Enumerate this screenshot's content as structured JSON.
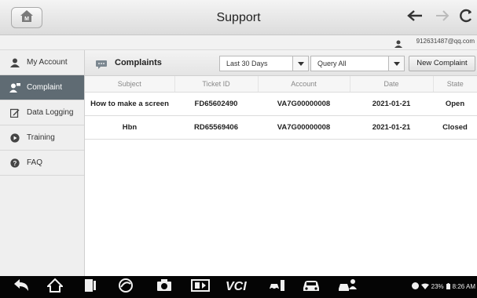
{
  "header": {
    "title": "Support"
  },
  "user": {
    "email": "912631487@qq.com"
  },
  "sidebar": {
    "items": [
      {
        "label": "My Account",
        "icon": "person-icon",
        "active": false
      },
      {
        "label": "Complaint",
        "icon": "complaint-icon",
        "active": true
      },
      {
        "label": "Data Logging",
        "icon": "edit-icon",
        "active": false
      },
      {
        "label": "Training",
        "icon": "play-icon",
        "active": false
      },
      {
        "label": "FAQ",
        "icon": "help-icon",
        "active": false
      }
    ]
  },
  "toolbar": {
    "title": "Complaints",
    "period_select": "Last 30 Days",
    "query_select": "Query All",
    "new_button": "New Complaint"
  },
  "table": {
    "columns": [
      "Subject",
      "Ticket ID",
      "Account",
      "Date",
      "State"
    ],
    "rows": [
      [
        "How to make a screen",
        "FD65602490",
        "VA7G00000008",
        "2021-01-21",
        "Open"
      ],
      [
        "Hbn",
        "RD65569406",
        "VA7G00000008",
        "2021-01-21",
        "Closed"
      ]
    ]
  },
  "statusbar": {
    "battery": "23%",
    "time": "8:26 AM"
  },
  "colors": {
    "active_sidebar": "#5f6b73",
    "navbar": "#050505",
    "header_bg": "#e6e6e6"
  }
}
